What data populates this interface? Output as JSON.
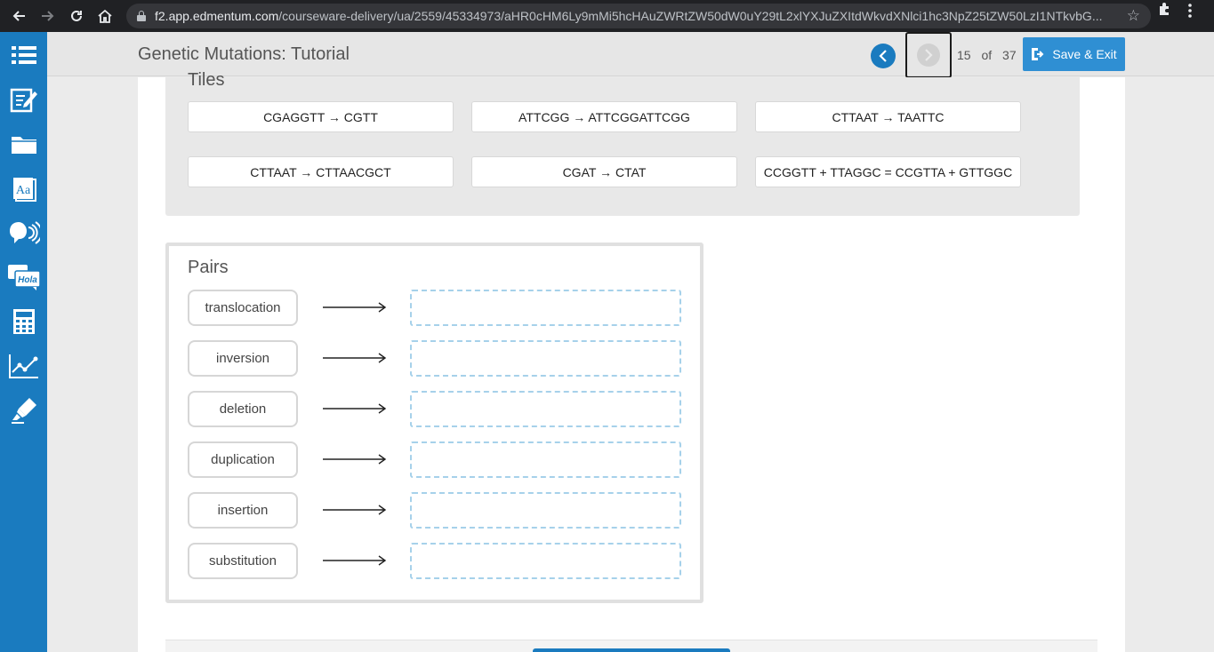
{
  "browser": {
    "url_host": "f2.app.edmentum.com",
    "url_path": "/courseware-delivery/ua/2559/45334973/aHR0cHM6Ly9mMi5hcHAuZWRtZW50dW0uY29tL2xlYXJuZXItdWkvdXNlci1hc3NpZ25tZW50LzI1NTkvbG..."
  },
  "sidebar": {
    "items": [
      {
        "icon": "menu-list-icon"
      },
      {
        "icon": "notepad-pencil-icon"
      },
      {
        "icon": "folder-icon"
      },
      {
        "icon": "dictionary-icon"
      },
      {
        "icon": "text-to-speech-icon"
      },
      {
        "icon": "translation-icon",
        "badge": "Hola"
      },
      {
        "icon": "calculator-icon"
      },
      {
        "icon": "graph-icon"
      },
      {
        "icon": "highlighter-icon"
      }
    ],
    "dictionary_glyph": "Aa"
  },
  "header": {
    "title": "Genetic Mutations: Tutorial",
    "current_page": "15",
    "of_label": "of",
    "total_pages": "37",
    "save_exit_label": "Save & Exit"
  },
  "tiles": {
    "heading": "Tiles",
    "items": [
      "CGAGGTT → CGTT",
      "ATTCGG → ATTCGGATTCGG",
      "CTTAAT → TAATTC",
      "CTTAAT → CTTAACGCT",
      "CGAT → CTAT",
      "CCGGTT + TTAGGC = CCGTTA + GTTGGC"
    ]
  },
  "pairs": {
    "heading": "Pairs",
    "labels": [
      "translocation",
      "inversion",
      "deletion",
      "duplication",
      "insertion",
      "substitution"
    ]
  },
  "colors": {
    "brand_blue": "#1a7bbf",
    "button_blue": "#2f8fd3",
    "drop_zone_border": "#a6d1ea"
  }
}
